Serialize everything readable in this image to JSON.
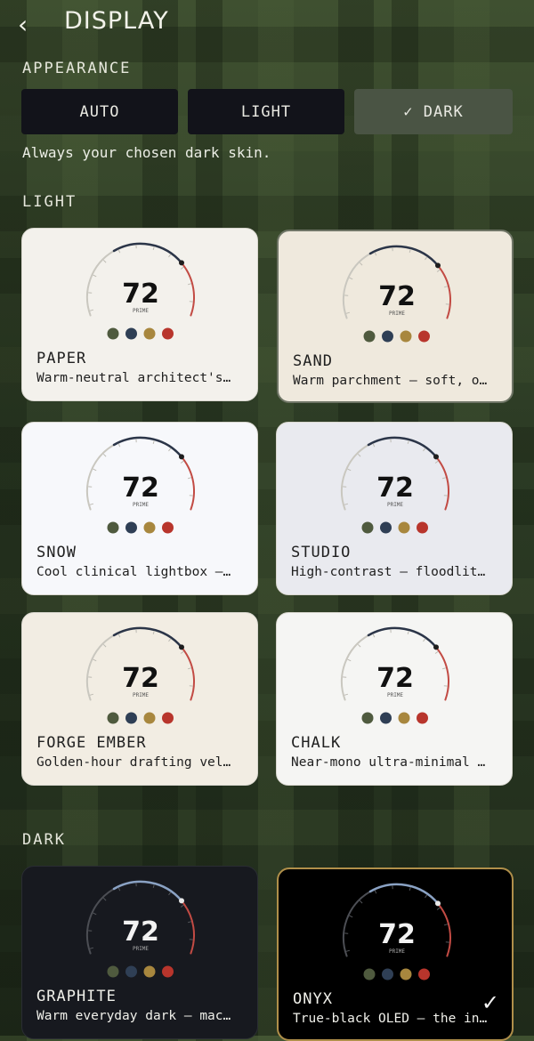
{
  "header": {
    "back_icon": "chevron-left-icon",
    "title": "DISPLAY"
  },
  "appearance": {
    "label": "APPEARANCE",
    "options": [
      {
        "label": "AUTO"
      },
      {
        "label": "LIGHT"
      },
      {
        "label": "✓ DARK"
      }
    ],
    "selected": "DARK",
    "hint": "Always your chosen dark skin."
  },
  "light_section": {
    "label": "LIGHT"
  },
  "dark_section": {
    "label": "DARK"
  },
  "gauge": {
    "value": "72",
    "caption": "PRIME"
  },
  "swatches": [
    "#4f5a3e",
    "#2f3f55",
    "#a8873e",
    "#b8352c"
  ],
  "themes": [
    {
      "name": "PAPER",
      "desc": "Warm-neutral architect's…",
      "bg": "#f3f1ec",
      "text": "#202020"
    },
    {
      "name": "SAND",
      "desc": "Warm parchment — soft, o…",
      "bg": "#efe9dd",
      "text": "#202020"
    },
    {
      "name": "SNOW",
      "desc": "Cool clinical lightbox —…",
      "bg": "#f7f8fb",
      "text": "#202020"
    },
    {
      "name": "STUDIO",
      "desc": "High-contrast — floodlit…",
      "bg": "#e9eaef",
      "text": "#202020"
    },
    {
      "name": "FORGE EMBER",
      "desc": "Golden-hour drafting vel…",
      "bg": "#f2ede3",
      "text": "#202020"
    },
    {
      "name": "CHALK",
      "desc": "Near-mono ultra-minimal …",
      "bg": "#f5f5f3",
      "text": "#202020"
    },
    {
      "name": "GRAPHITE",
      "desc": "Warm everyday dark — mac…",
      "bg": "#17191f",
      "text": "#f0f0ea"
    },
    {
      "name": "ONYX",
      "desc": "True-black OLED — the in…",
      "bg": "#000000",
      "text": "#f0f0ea",
      "selected": true
    }
  ]
}
